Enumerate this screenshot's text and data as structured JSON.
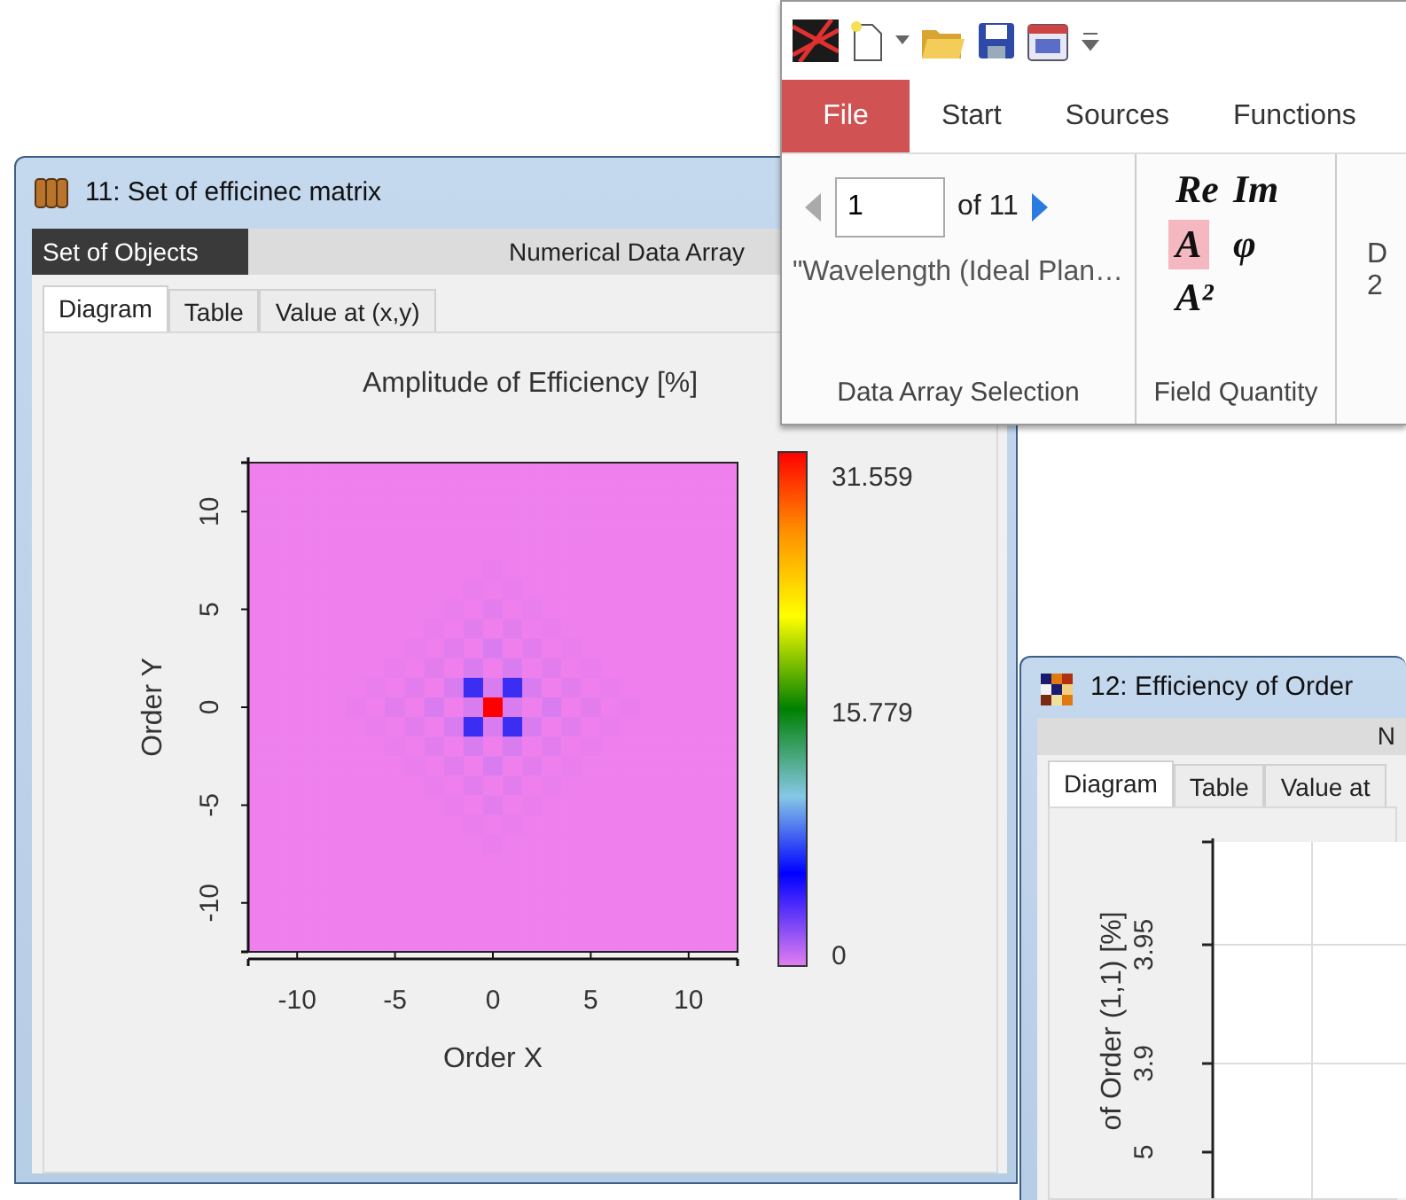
{
  "diagram_window": {
    "title": "11: Set of efficinec matrix",
    "toolbar": {
      "panel_label": "Set of Objects",
      "data_label": "Numerical Data Array"
    },
    "tabs": [
      {
        "label": "Diagram",
        "selected": true
      },
      {
        "label": "Table",
        "selected": false
      },
      {
        "label": "Value at (x,y)",
        "selected": false
      }
    ],
    "plot": {
      "title": "Amplitude of Efficiency  [%]",
      "xlabel": "Order X",
      "ylabel": "Order Y",
      "xticks": [
        "-10",
        "-5",
        "0",
        "5",
        "10"
      ],
      "yticks": [
        "10",
        "5",
        "0",
        "-5",
        "-10"
      ],
      "colorbar_labels": [
        "31.559",
        "15.779",
        "0"
      ]
    }
  },
  "ribbon": {
    "tabs": [
      {
        "label": "File",
        "selected": true
      },
      {
        "label": "Start",
        "selected": false
      },
      {
        "label": "Sources",
        "selected": false
      },
      {
        "label": "Functions",
        "selected": false
      }
    ],
    "array_selection": {
      "index": "1",
      "count": "of 11",
      "name": "\"Wavelength (Ideal Plan…",
      "group_label": "Data Array Selection"
    },
    "field_quantity": {
      "options": [
        {
          "label": "Re",
          "selected": false
        },
        {
          "label": "Im",
          "selected": false
        },
        {
          "label": "A",
          "selected": true
        },
        {
          "label": "φ",
          "selected": false
        },
        {
          "label": "A²",
          "selected": false
        }
      ],
      "group_label": "Field Quantity"
    },
    "cut_group": [
      "D",
      "2"
    ]
  },
  "chart_window": {
    "title": "12: Efficiency of Order",
    "toolbar_text": "N",
    "tabs": [
      {
        "label": "Diagram",
        "selected": true
      },
      {
        "label": "Table",
        "selected": false
      },
      {
        "label": "Value at",
        "selected": false
      }
    ],
    "plot": {
      "ylabel": "of Order (1,1) [%]",
      "yticks": [
        "3.95",
        "3.9",
        "5"
      ]
    }
  }
}
